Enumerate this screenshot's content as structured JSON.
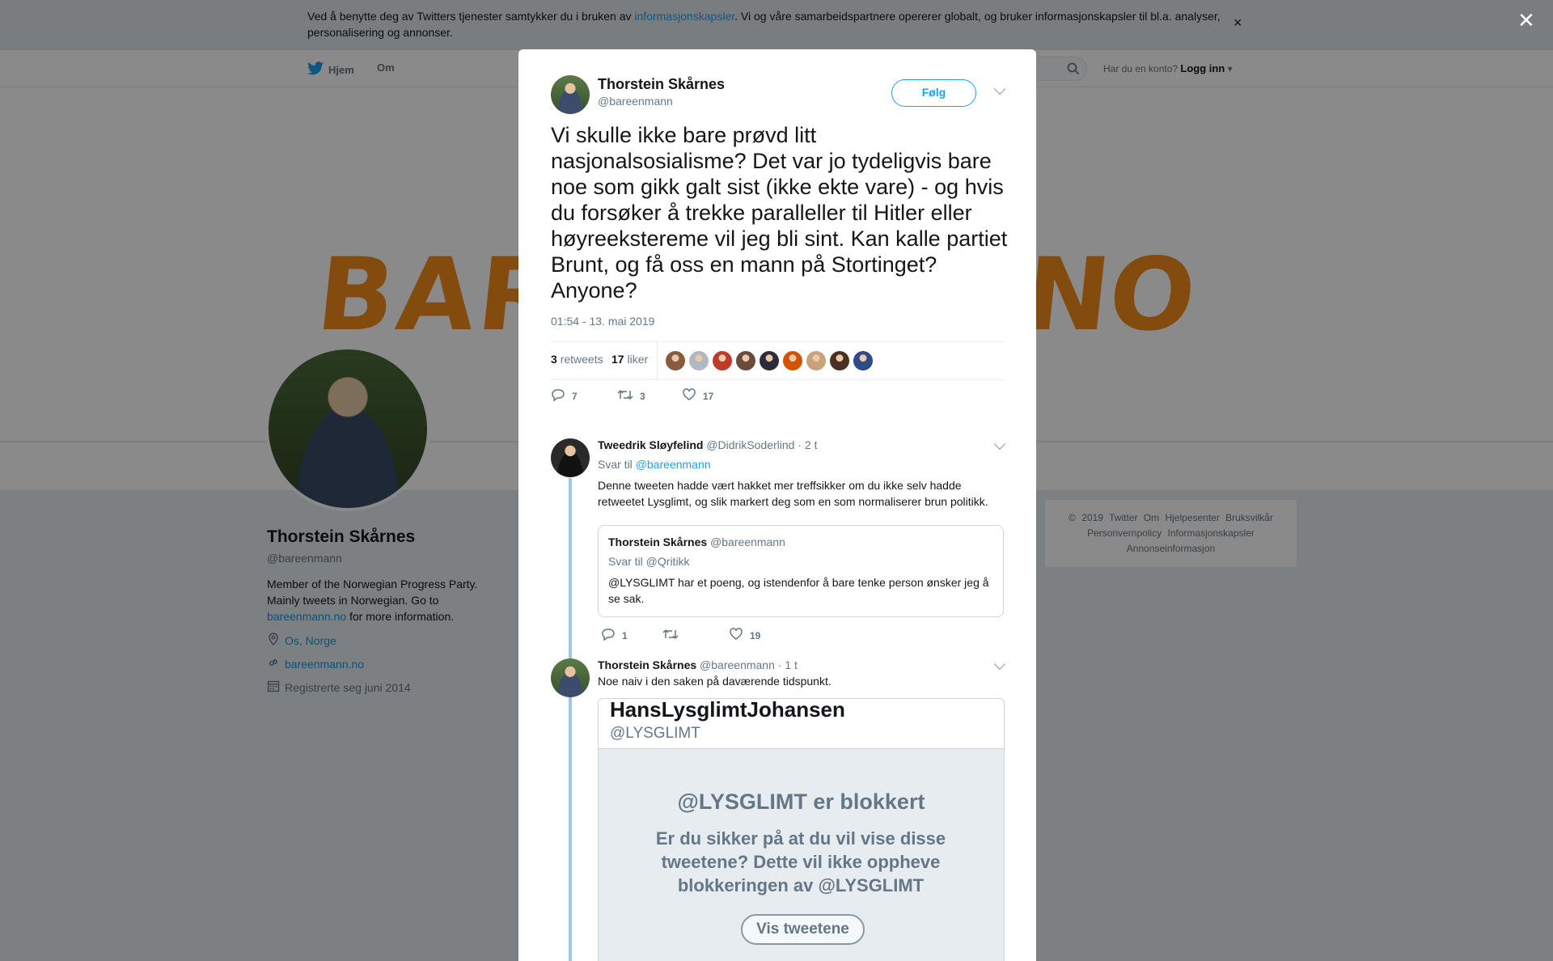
{
  "cookie": {
    "text_before": "Ved å benytte deg av Twitters tjenester samtykker du i bruken av ",
    "link": "informasjonskapsler",
    "text_after": ". Vi og våre samarbeidspartnere opererer globalt, og bruker informasjonskapsler til bl.a. analyser, personalisering og annonser.",
    "close": "×"
  },
  "nav": {
    "home": "Hjem",
    "about": "Om",
    "account_prompt": "Har du en konto?",
    "login": "Logg inn"
  },
  "banner": {
    "logo_left": "BAR",
    "logo_right": "NO"
  },
  "profile": {
    "name": "Thorstein Skårnes",
    "handle": "@bareenmann",
    "bio_before": "Member of the Norwegian Progress Party. Mainly tweets in Norwegian. Go to ",
    "bio_link": "bareenmann.no",
    "bio_after": " for more information.",
    "location": "Os, Norge",
    "website": "bareenmann.no",
    "joined": "Registrerte seg juni 2014"
  },
  "footer": {
    "line1": "© 2019 Twitter  Om  Hjelpesenter  Bruksvilkår",
    "line2": "Personvernpolicy  Informasjonskapsler",
    "line3": "Annonseinformasjon"
  },
  "modal_close": "✕",
  "tweet": {
    "name": "Thorstein Skårnes",
    "handle": "@bareenmann",
    "follow": "Følg",
    "text": "Vi skulle ikke bare prøvd litt nasjonalsosialisme? Det var jo tydeligvis bare noe som gikk galt sist (ikke ekte vare) - og hvis du forsøker å trekke paralleller til Hitler eller høyreekstereme vil jeg bli sint. Kan kalle partiet Brunt, og få oss en mann på Stortinget? Anyone?",
    "time": "01:54 - 13. mai 2019",
    "retweets_count": "3",
    "retweets_label": "retweets",
    "likes_count": "17",
    "likes_label": "liker",
    "replies": "7",
    "retweets": "3",
    "likes": "17",
    "liker_colors": [
      "#8a5a3c",
      "#b0b8c4",
      "#c0392b",
      "#6b4a3a",
      "#2c2c3a",
      "#d35400",
      "#c8a27a",
      "#4a3222",
      "#2e4a8a"
    ]
  },
  "reply1": {
    "name": "Tweedrik Sløyfelind",
    "handle": "@DidrikSoderlind",
    "time": "· 2 t",
    "reply_to_label": "Svar til",
    "reply_to": "@bareenmann",
    "text": "Denne tweeten hadde vært hakket mer treffsikker om du ikke selv hadde retweetet Lysglimt, og slik markert deg som en som normaliserer brun politikk.",
    "quote": {
      "name": "Thorstein Skårnes",
      "handle": "@bareenmann",
      "reply_to": "Svar til @Qritikk",
      "text": "@LYSGLIMT har et poeng, og istendenfor å bare tenke person ønsker jeg å se sak."
    },
    "replies": "1",
    "likes": "19"
  },
  "reply2": {
    "name": "Thorstein Skårnes",
    "handle": "@bareenmann",
    "time": "· 1 t",
    "text": "Noe naiv i den saken på daværende tidspunkt.",
    "media": {
      "name": "HansLysglimtJohansen",
      "handle": "@LYSGLIMT",
      "title": "@LYSGLIMT er blokkert",
      "question": "Er du sikker på at du vil vise disse tweetene? Dette vil ikke oppheve blokkeringen av @LYSGLIMT",
      "button": "Vis tweetene"
    }
  }
}
